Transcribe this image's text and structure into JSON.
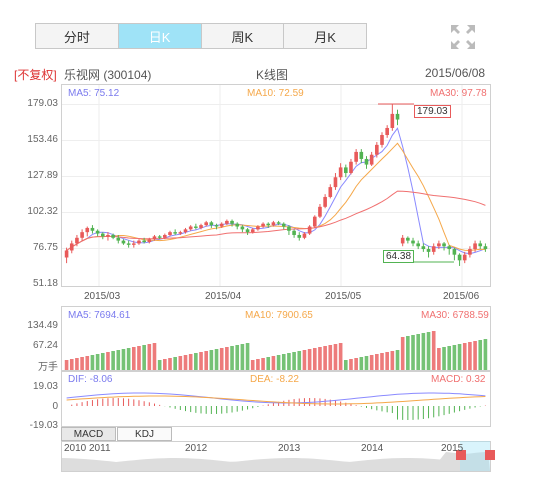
{
  "tabs": [
    "分时",
    "日K",
    "周K",
    "月K"
  ],
  "active_tab": 1,
  "header": {
    "adjust": "[不复权]",
    "stock": "乐视网 (300104)",
    "chart_title": "K线图",
    "date": "2015/06/08"
  },
  "main_legend": {
    "ma5": "MA5: 75.12",
    "ma10": "MA10: 72.59",
    "ma30": "MA30: 97.78"
  },
  "vol_legend": {
    "ma5": "MA5: 7694.61",
    "ma10": "MA10: 7900.65",
    "ma30": "MA30: 6788.59"
  },
  "macd_legend": {
    "dif": "DIF: -8.06",
    "dea": "DEA: -8.22",
    "macd": "MACD: 0.32"
  },
  "price_axis": [
    "179.03",
    "153.46",
    "127.89",
    "102.32",
    "76.75",
    "51.18"
  ],
  "vol_axis": [
    "134.49",
    "67.24",
    "万手"
  ],
  "macd_axis": [
    "19.03",
    "0",
    "-19.03"
  ],
  "date_axis": [
    "2015/03",
    "2015/04",
    "2015/05",
    "2015/06"
  ],
  "high_label": "179.03",
  "low_label": "64.38",
  "sub_tabs": [
    "MACD",
    "KDJ"
  ],
  "overview_years": [
    "2010",
    "2011",
    "2012",
    "2013",
    "2014",
    "2015"
  ],
  "colors": {
    "up": "#e85a5a",
    "down": "#52b352",
    "ma5": "#8a8aff",
    "ma10": "#f5a84a",
    "ma30": "#f07070",
    "accent": "#9fe3f7"
  },
  "chart_data": {
    "type": "candlestick",
    "ylim": [
      51.18,
      179.03
    ],
    "candles": [
      [
        70,
        75,
        66,
        77
      ],
      [
        75,
        80,
        73,
        82
      ],
      [
        80,
        84,
        78,
        86
      ],
      [
        84,
        88,
        82,
        90
      ],
      [
        88,
        91,
        85,
        92
      ],
      [
        91,
        89,
        87,
        93
      ],
      [
        89,
        87,
        85,
        90
      ],
      [
        87,
        85,
        83,
        88
      ],
      [
        85,
        86,
        82,
        88
      ],
      [
        86,
        84,
        83,
        87
      ],
      [
        84,
        82,
        80,
        86
      ],
      [
        82,
        80,
        79,
        83
      ],
      [
        80,
        79,
        77,
        82
      ],
      [
        79,
        80,
        77,
        82
      ],
      [
        80,
        82,
        79,
        83
      ],
      [
        82,
        81,
        80,
        84
      ],
      [
        81,
        83,
        80,
        84
      ],
      [
        83,
        85,
        82,
        86
      ],
      [
        85,
        84,
        83,
        86
      ],
      [
        84,
        86,
        83,
        87
      ],
      [
        86,
        88,
        85,
        89
      ],
      [
        88,
        87,
        86,
        90
      ],
      [
        87,
        88,
        86,
        89
      ],
      [
        88,
        90,
        87,
        91
      ],
      [
        90,
        92,
        89,
        93
      ],
      [
        92,
        91,
        90,
        94
      ],
      [
        91,
        93,
        90,
        94
      ],
      [
        93,
        95,
        92,
        96
      ],
      [
        95,
        93,
        91,
        96
      ],
      [
        93,
        92,
        90,
        94
      ],
      [
        92,
        94,
        91,
        95
      ],
      [
        94,
        96,
        93,
        97
      ],
      [
        96,
        94,
        92,
        97
      ],
      [
        94,
        92,
        90,
        95
      ],
      [
        92,
        90,
        88,
        93
      ],
      [
        90,
        88,
        86,
        91
      ],
      [
        88,
        90,
        87,
        91
      ],
      [
        90,
        92,
        89,
        93
      ],
      [
        92,
        94,
        91,
        95
      ],
      [
        94,
        93,
        91,
        95
      ],
      [
        93,
        95,
        92,
        96
      ],
      [
        95,
        94,
        93,
        96
      ],
      [
        94,
        92,
        90,
        95
      ],
      [
        92,
        89,
        86,
        93
      ],
      [
        89,
        86,
        84,
        90
      ],
      [
        86,
        84,
        82,
        88
      ],
      [
        84,
        87,
        83,
        88
      ],
      [
        87,
        92,
        86,
        93
      ],
      [
        92,
        99,
        91,
        100
      ],
      [
        99,
        106,
        98,
        108
      ],
      [
        106,
        113,
        105,
        115
      ],
      [
        113,
        120,
        112,
        122
      ],
      [
        120,
        127,
        118,
        130
      ],
      [
        127,
        134,
        125,
        137
      ],
      [
        134,
        130,
        127,
        136
      ],
      [
        130,
        138,
        129,
        140
      ],
      [
        138,
        145,
        136,
        147
      ],
      [
        145,
        140,
        137,
        147
      ],
      [
        140,
        136,
        133,
        142
      ],
      [
        136,
        143,
        135,
        145
      ],
      [
        143,
        150,
        141,
        152
      ],
      [
        150,
        157,
        148,
        159
      ],
      [
        157,
        162,
        155,
        164
      ],
      [
        162,
        172,
        160,
        179
      ],
      [
        172,
        168,
        164,
        175
      ],
      [
        80,
        84,
        78,
        86
      ],
      [
        84,
        82,
        80,
        85
      ],
      [
        82,
        80,
        78,
        84
      ],
      [
        80,
        78,
        76,
        82
      ],
      [
        78,
        76,
        74,
        80
      ],
      [
        76,
        74,
        70,
        78
      ],
      [
        74,
        78,
        72,
        80
      ],
      [
        78,
        80,
        76,
        82
      ],
      [
        80,
        78,
        75,
        81
      ],
      [
        78,
        76,
        72,
        79
      ],
      [
        76,
        72,
        68,
        77
      ],
      [
        72,
        68,
        64,
        73
      ],
      [
        68,
        72,
        66,
        74
      ],
      [
        72,
        76,
        70,
        78
      ],
      [
        76,
        80,
        74,
        82
      ],
      [
        80,
        78,
        76,
        82
      ],
      [
        78,
        76,
        74,
        80
      ]
    ]
  }
}
